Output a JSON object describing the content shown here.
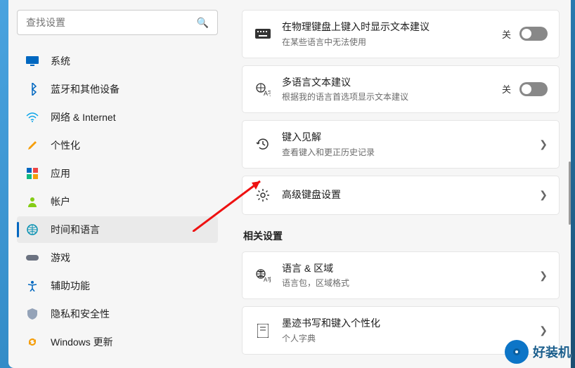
{
  "search": {
    "placeholder": "查找设置"
  },
  "sidebar": {
    "items": [
      {
        "label": "系统",
        "icon": "display-icon",
        "selected": false
      },
      {
        "label": "蓝牙和其他设备",
        "icon": "bluetooth-icon",
        "selected": false
      },
      {
        "label": "网络 & Internet",
        "icon": "wifi-icon",
        "selected": false
      },
      {
        "label": "个性化",
        "icon": "paintbrush-icon",
        "selected": false
      },
      {
        "label": "应用",
        "icon": "apps-icon",
        "selected": false
      },
      {
        "label": "帐户",
        "icon": "person-icon",
        "selected": false
      },
      {
        "label": "时间和语言",
        "icon": "globe-clock-icon",
        "selected": true
      },
      {
        "label": "游戏",
        "icon": "gamepad-icon",
        "selected": false
      },
      {
        "label": "辅助功能",
        "icon": "accessibility-icon",
        "selected": false
      },
      {
        "label": "隐私和安全性",
        "icon": "shield-icon",
        "selected": false
      },
      {
        "label": "Windows 更新",
        "icon": "update-icon",
        "selected": false
      }
    ]
  },
  "main": {
    "cards": [
      {
        "title": "在物理键盘上键入时显示文本建议",
        "subtitle": "在某些语言中无法使用",
        "control": "toggle",
        "state_label": "关"
      },
      {
        "title": "多语言文本建议",
        "subtitle": "根据我的语言首选项显示文本建议",
        "control": "toggle",
        "state_label": "关"
      },
      {
        "title": "键入见解",
        "subtitle": "查看键入和更正历史记录",
        "control": "chevron"
      },
      {
        "title": "高级键盘设置",
        "subtitle": "",
        "control": "chevron"
      }
    ],
    "related_title": "相关设置",
    "related": [
      {
        "title": "语言 & 区域",
        "subtitle": "语言包，区域格式",
        "control": "chevron"
      },
      {
        "title": "墨迹书写和键入个性化",
        "subtitle": "个人字典",
        "control": "chevron"
      }
    ]
  },
  "watermark": {
    "text": "好装机"
  }
}
